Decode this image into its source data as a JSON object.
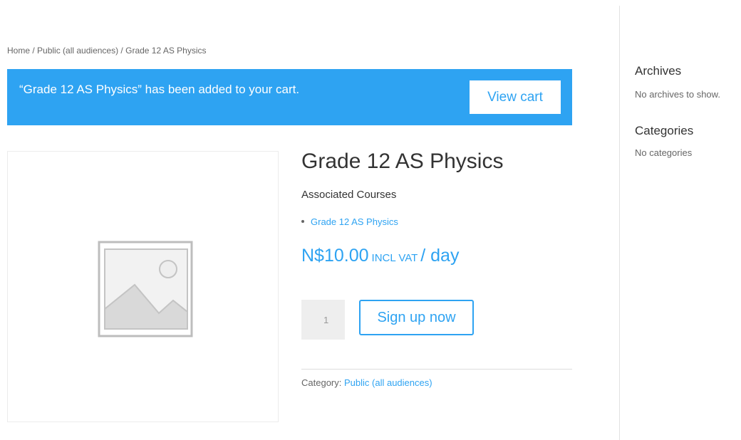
{
  "breadcrumb": {
    "home": "Home",
    "sep1": " / ",
    "category": "Public (all audiences)",
    "sep2": " / ",
    "current": "Grade 12 AS Physics"
  },
  "notice": {
    "message": "“Grade 12 AS Physics” has been added to your cart.",
    "view_cart_label": "View cart"
  },
  "product": {
    "image_icon": "image-placeholder-icon",
    "title": "Grade 12 AS Physics",
    "associated_heading": "Associated Courses",
    "courses": [
      "Grade 12 AS Physics"
    ],
    "price_amount": "N$10.00",
    "price_tax": "INCL VAT",
    "price_period": "/ day",
    "quantity": "1",
    "signup_label": "Sign up now",
    "category_label": "Category:",
    "category_value": "Public (all audiences)"
  },
  "sidebar": {
    "archives_title": "Archives",
    "archives_text": "No archives to show.",
    "categories_title": "Categories",
    "categories_text": "No categories"
  },
  "colors": {
    "accent": "#2ea3f2",
    "text": "#666666",
    "heading": "#333333"
  }
}
